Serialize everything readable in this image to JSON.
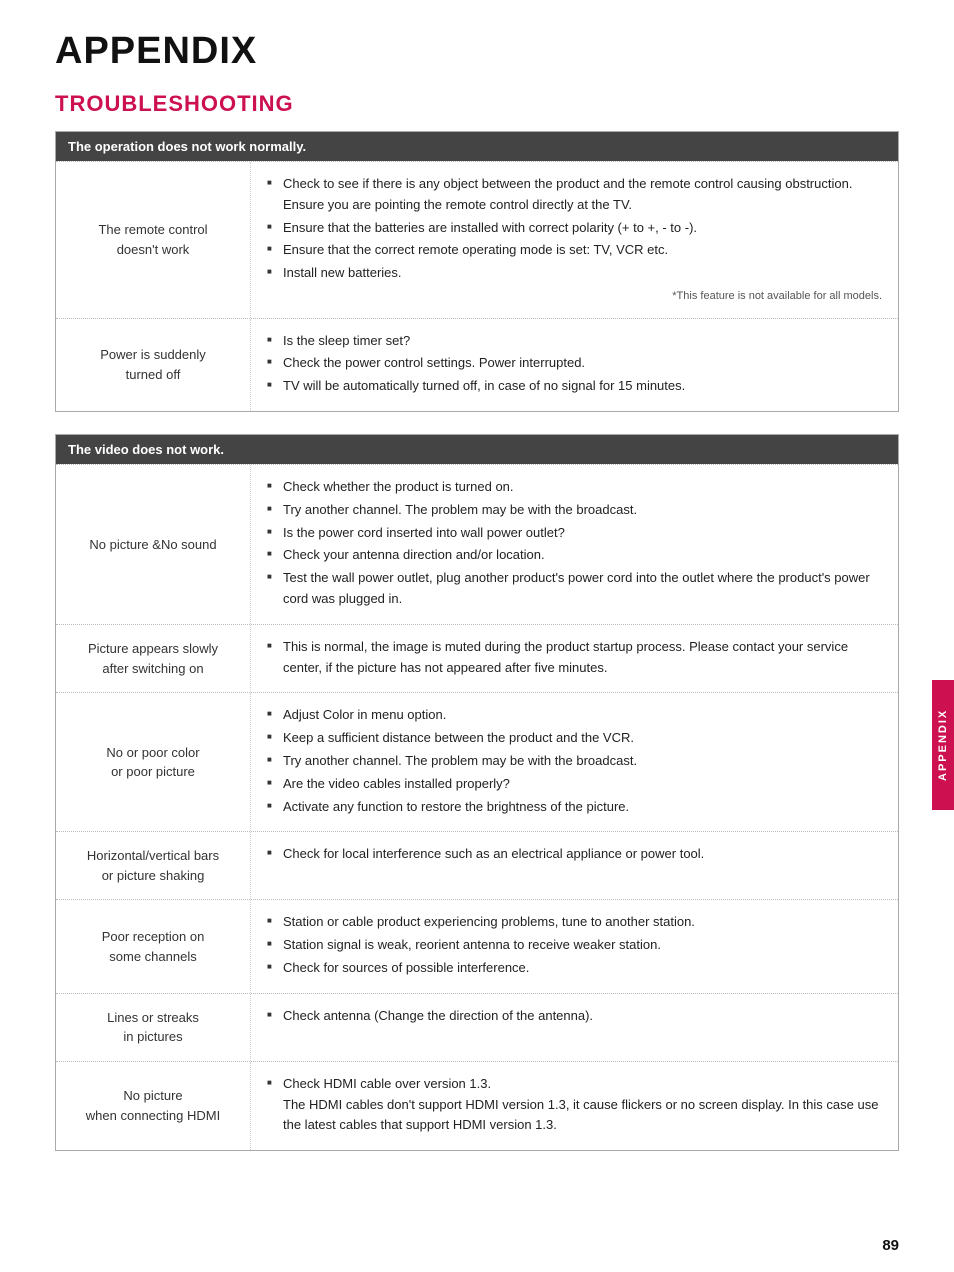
{
  "page": {
    "title": "APPENDIX",
    "section": "TROUBLESHOOTING",
    "page_number": "89",
    "side_tab": "APPENDIX"
  },
  "table1": {
    "header": "The operation does not work normally.",
    "rows": [
      {
        "label": "The remote control\ndoesn't work",
        "items": [
          "Check to see if there is any object between the product and the remote control causing obstruction. Ensure you are pointing the remote control directly at the TV.",
          "Ensure that the batteries are installed with correct polarity (+ to +, - to -).",
          "Ensure that the correct remote operating mode is set: TV, VCR etc.",
          "Install new batteries."
        ],
        "footnote": "*This feature is not available for all models."
      },
      {
        "label": "Power is suddenly\nturned off",
        "items": [
          "Is the sleep timer set?",
          "Check the power control settings. Power interrupted.",
          "TV will be automatically turned off, in case of no signal for 15 minutes."
        ],
        "footnote": ""
      }
    ]
  },
  "table2": {
    "header": "The video does not work.",
    "rows": [
      {
        "label": "No picture &No sound",
        "items": [
          "Check whether the product is turned on.",
          "Try another channel. The problem may be with the broadcast.",
          "Is the power cord inserted into wall power outlet?",
          "Check your antenna direction and/or location.",
          "Test the wall power outlet, plug another product's power cord into the outlet where the product's power cord was plugged in."
        ],
        "footnote": ""
      },
      {
        "label": "Picture appears slowly\nafter switching on",
        "items": [
          "This is normal, the image is muted during the product startup process. Please contact your service center, if the picture has not appeared after five minutes."
        ],
        "footnote": ""
      },
      {
        "label": "No or poor color\nor poor picture",
        "items": [
          "Adjust Color in menu option.",
          "Keep a sufficient distance between the product and the VCR.",
          "Try another channel. The problem may be with the broadcast.",
          "Are the video cables installed properly?",
          "Activate any function to restore the brightness of the picture."
        ],
        "footnote": ""
      },
      {
        "label": "Horizontal/vertical bars\nor picture shaking",
        "items": [
          "Check for local interference such as an electrical appliance or power tool."
        ],
        "footnote": ""
      },
      {
        "label": "Poor reception on\nsome channels",
        "items": [
          "Station or cable product experiencing problems, tune to another station.",
          "Station signal is weak, reorient antenna to receive weaker station.",
          "Check for sources of possible interference."
        ],
        "footnote": ""
      },
      {
        "label": "Lines or streaks\nin pictures",
        "items": [
          "Check antenna (Change the direction of the antenna)."
        ],
        "footnote": ""
      },
      {
        "label": "No picture\nwhen connecting HDMI",
        "items": [
          "Check HDMI cable over version 1.3.",
          "The HDMI cables don't support HDMI version 1.3, it cause flickers or no screen display. In this case use the latest cables that support HDMI version 1.3."
        ],
        "footnote": ""
      }
    ]
  }
}
